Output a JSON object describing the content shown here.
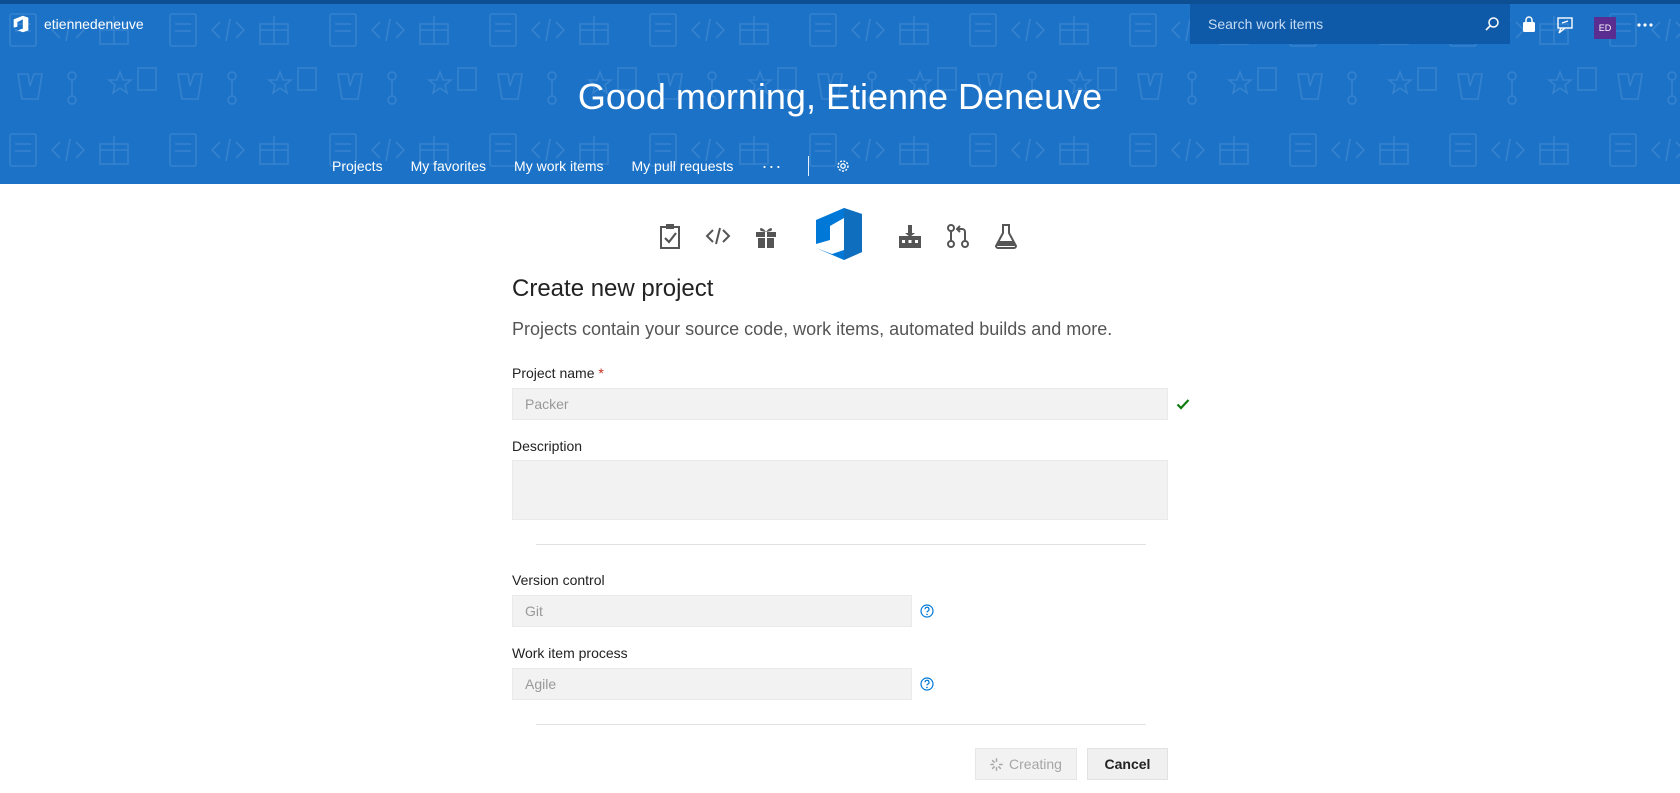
{
  "header": {
    "org_name": "etiennedeneuve",
    "search_placeholder": "Search work items",
    "avatar_initials": "ED",
    "greeting": "Good morning, Etienne Deneuve",
    "nav": {
      "projects": "Projects",
      "favorites": "My favorites",
      "work_items": "My work items",
      "pull_requests": "My pull requests",
      "more": "···"
    }
  },
  "form": {
    "title": "Create new project",
    "subtitle": "Projects contain your source code, work items, automated builds and more.",
    "project_name_label": "Project name",
    "required_marker": "*",
    "project_name_value": "Packer",
    "description_label": "Description",
    "description_value": "",
    "version_control_label": "Version control",
    "version_control_value": "Git",
    "process_label": "Work item process",
    "process_value": "Agile",
    "creating_label": "Creating",
    "cancel_label": "Cancel"
  },
  "colors": {
    "banner": "#1b72c6",
    "accent": "#0078d7",
    "success": "#107c10",
    "avatar": "#5c2d91"
  },
  "icons": {
    "services": [
      "boards-clipboard-icon",
      "code-icon",
      "artifacts-gift-icon",
      "vsts-logo-icon",
      "build-factory-icon",
      "pull-request-icon",
      "test-flask-icon"
    ]
  }
}
